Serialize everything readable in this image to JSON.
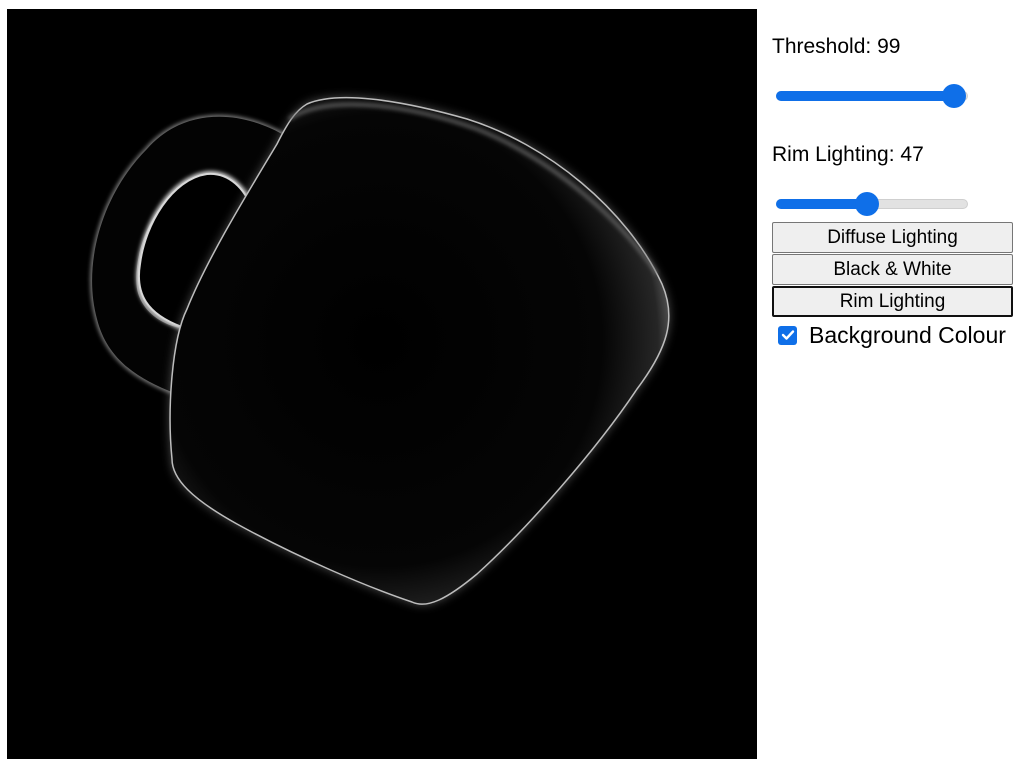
{
  "viewport": {
    "background": "#000000",
    "object": "mug",
    "render_mode": "rim-lighting"
  },
  "controls": {
    "threshold": {
      "label_prefix": "Threshold: ",
      "value": 99,
      "min": 0,
      "max": 100
    },
    "rim_lighting": {
      "label_prefix": "Rim Lighting: ",
      "value": 47,
      "min": 0,
      "max": 100
    },
    "buttons": [
      {
        "label": "Diffuse Lighting"
      },
      {
        "label": "Black & White"
      },
      {
        "label": "Rim Lighting"
      }
    ],
    "background_colour": {
      "label": "Background Colour",
      "checked": true
    }
  },
  "colors": {
    "accent": "#0f6fe8",
    "button_bg": "#efefef"
  },
  "icons": {
    "checkbox": "check-icon"
  }
}
